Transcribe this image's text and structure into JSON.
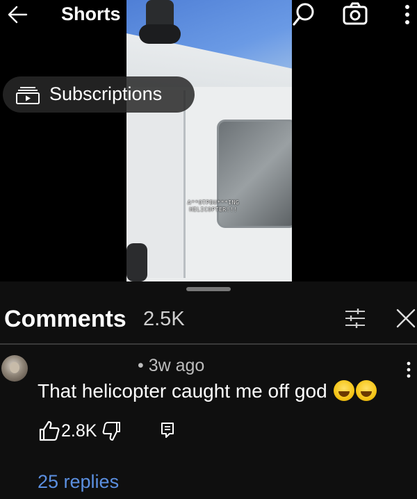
{
  "header": {
    "title": "Shorts",
    "back_icon": "arrow-left-icon",
    "search_icon": "search-icon",
    "camera_icon": "camera-icon",
    "more_icon": "more-vertical-icon"
  },
  "video": {
    "caption_line1": "A**OTPBU***ING",
    "caption_line2": "HELICOPTER!!!"
  },
  "subscriptions": {
    "label": "Subscriptions",
    "icon": "subscriptions-icon"
  },
  "comments": {
    "title": "Comments",
    "count": "2.5K",
    "filter_icon": "filter-icon",
    "close_icon": "close-icon",
    "items": [
      {
        "meta": "• 3w ago",
        "text": "That helicopter caught me off god",
        "emojis": [
          "face-with-tears-of-joy",
          "face-with-tears-of-joy"
        ],
        "likes": "2.8K",
        "replies_label": "25 replies"
      }
    ]
  },
  "colors": {
    "background": "#000000",
    "panel": "#0f0f0f",
    "link": "#5b8fe0",
    "muted_text": "#bdbdbd"
  }
}
